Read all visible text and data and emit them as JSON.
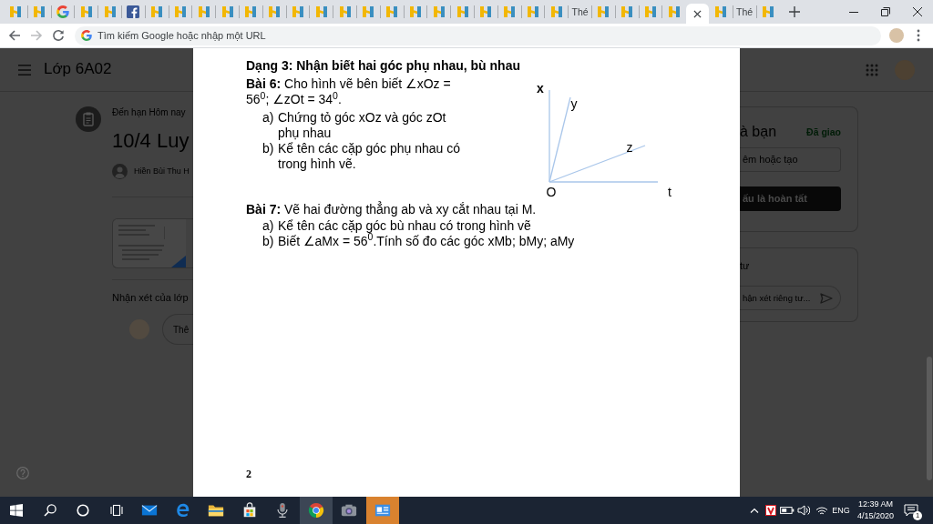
{
  "browser": {
    "tabs": [
      {
        "kind": "h",
        "selected": false
      },
      {
        "kind": "h",
        "selected": false
      },
      {
        "kind": "google",
        "selected": false
      },
      {
        "kind": "h",
        "selected": false
      },
      {
        "kind": "h",
        "selected": false
      },
      {
        "kind": "facebook",
        "selected": false
      },
      {
        "kind": "h",
        "selected": false
      },
      {
        "kind": "h",
        "selected": false
      },
      {
        "kind": "h",
        "selected": false
      },
      {
        "kind": "h",
        "selected": false
      },
      {
        "kind": "h",
        "selected": false
      },
      {
        "kind": "h",
        "selected": false
      },
      {
        "kind": "h",
        "selected": false
      },
      {
        "kind": "h",
        "selected": false
      },
      {
        "kind": "h",
        "selected": false
      },
      {
        "kind": "h",
        "selected": false
      },
      {
        "kind": "h",
        "selected": false
      },
      {
        "kind": "h",
        "selected": false
      },
      {
        "kind": "h",
        "selected": false
      },
      {
        "kind": "h",
        "selected": false
      },
      {
        "kind": "h",
        "selected": false
      },
      {
        "kind": "h",
        "selected": false
      },
      {
        "kind": "h",
        "selected": false
      },
      {
        "kind": "h",
        "selected": false
      },
      {
        "kind": "text",
        "title": "Thé",
        "selected": false
      },
      {
        "kind": "h",
        "selected": false
      },
      {
        "kind": "h",
        "selected": false
      },
      {
        "kind": "h",
        "selected": false
      },
      {
        "kind": "h",
        "selected": false
      },
      {
        "selected": true
      },
      {
        "kind": "h",
        "selected": false
      },
      {
        "kind": "text",
        "title": "Thé",
        "selected": false
      },
      {
        "kind": "h",
        "selected": false
      }
    ],
    "back": {
      "disabled": false
    },
    "forward": {
      "disabled": true
    },
    "omnibox": {
      "placeholder": "Tìm kiếm Google hoặc nhập một URL"
    }
  },
  "classroom": {
    "class_name": "Lớp 6A02",
    "assignment": {
      "due": "Đến hạn Hôm nay",
      "title": "10/4 Luy",
      "author": "Hiền Bùi Thu H"
    },
    "class_comments": {
      "heading": "Nhận xét của lớp",
      "placeholder": "Thê"
    },
    "your_work": {
      "title": "à bạn",
      "status": "Đã giao",
      "add_button": "êm hoặc tạo",
      "done_button": "ấu là hoàn tất"
    },
    "private_comments": {
      "heading": "tư",
      "placeholder": "hận xét riêng tư..."
    }
  },
  "document": {
    "heading": "Dạng 3: Nhận biết hai góc phụ nhau, bù nhau",
    "exercises": [
      {
        "text": "**Bài 6:** Cho hình vẽ bên biết ∠xOz = 56$^{0}$; ∠zOt = 34$^{0}$.",
        "items": [
          {
            "marker": "a)",
            "text": "Chứng tỏ góc xOz và góc zOt phụ nhau"
          },
          {
            "marker": "b)",
            "text": "Kể tên các cặp góc phụ nhau có trong hình vẽ."
          }
        ],
        "diagram": {
          "vertex": "O",
          "rays": [
            {
              "label": "x"
            },
            {
              "label": "y"
            },
            {
              "label": "z"
            },
            {
              "label": "t"
            }
          ]
        }
      },
      {
        "text": "**Bài 7:** Vẽ hai đường thẳng ab và xy cắt nhau tại M.",
        "items": [
          {
            "marker": "a)",
            "text": "Kể tên các cặp góc bù nhau có trong hình vẽ"
          },
          {
            "marker": "b)",
            "text": "Biết ∠aMx = 56$^{0}$.Tính số đo các góc xMb; bMy; aMy"
          }
        ]
      }
    ],
    "page_number": "2"
  },
  "taskbar": {
    "apps": [
      {
        "kind": "mail",
        "active": false,
        "attention": false
      },
      {
        "kind": "edge",
        "active": false,
        "attention": false
      },
      {
        "kind": "explorer",
        "active": false,
        "attention": false
      },
      {
        "kind": "store",
        "active": false,
        "attention": false
      },
      {
        "kind": "recorder",
        "active": false,
        "attention": false
      },
      {
        "kind": "chrome",
        "active": true,
        "attention": false
      },
      {
        "kind": "camera",
        "active": false,
        "attention": false
      },
      {
        "kind": "window",
        "active": false,
        "attention": true
      }
    ],
    "tray": {
      "language": "ENG",
      "time": "12:39 AM",
      "date": "4/15/2020",
      "notifications": "1"
    }
  }
}
